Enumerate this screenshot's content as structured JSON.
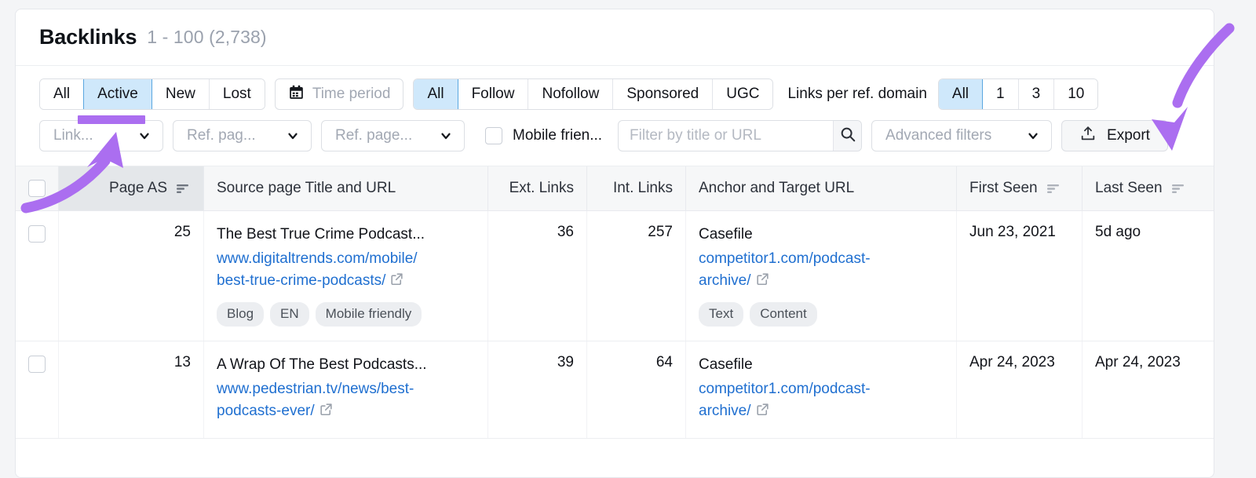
{
  "header": {
    "title": "Backlinks",
    "range_count": "1 - 100 (2,738)"
  },
  "filters": {
    "status_group": {
      "name": "backlink-status",
      "options": [
        "All",
        "Active",
        "New",
        "Lost"
      ],
      "selected": "Active"
    },
    "time_period": {
      "label": "Time period",
      "icon": "calendar-icon"
    },
    "link_type_group": {
      "name": "link-attribute",
      "options": [
        "All",
        "Follow",
        "Nofollow",
        "Sponsored",
        "UGC"
      ],
      "selected": "All"
    },
    "links_per_domain": {
      "label": "Links per ref. domain",
      "options": [
        "All",
        "1",
        "3",
        "10"
      ],
      "selected": "All"
    },
    "dropdowns": [
      {
        "name": "link-attributes-dropdown",
        "value": "Link..."
      },
      {
        "name": "ref-page-category-dropdown",
        "value": "Ref. pag..."
      },
      {
        "name": "ref-page-language-dropdown",
        "value": "Ref. page..."
      }
    ],
    "mobile_friendly": {
      "label": "Mobile frien...",
      "checked": false
    },
    "search": {
      "placeholder": "Filter by title or URL",
      "value": "",
      "icon": "search-icon"
    },
    "advanced_filters": {
      "label": "Advanced filters"
    },
    "export": {
      "label": "Export",
      "icon": "upload-icon"
    }
  },
  "table": {
    "columns": [
      {
        "key": "select",
        "label": "",
        "sortable": false,
        "sorted": false
      },
      {
        "key": "page_as",
        "label": "Page AS",
        "sortable": true,
        "sorted": true
      },
      {
        "key": "source",
        "label": "Source page Title and URL",
        "sortable": false,
        "sorted": false
      },
      {
        "key": "ext",
        "label": "Ext. Links",
        "sortable": false,
        "sorted": false
      },
      {
        "key": "int",
        "label": "Int. Links",
        "sortable": false,
        "sorted": false
      },
      {
        "key": "anchor",
        "label": "Anchor and Target URL",
        "sortable": false,
        "sorted": false
      },
      {
        "key": "first",
        "label": "First Seen",
        "sortable": true,
        "sorted": false
      },
      {
        "key": "last",
        "label": "Last Seen",
        "sortable": true,
        "sorted": false
      }
    ],
    "rows": [
      {
        "page_as": "25",
        "source_title": "The Best True Crime Podcast...",
        "source_url_line1": "www.digitaltrends.com/mobile/",
        "source_url_line2": "best-true-crime-podcasts/",
        "source_tags": [
          "Blog",
          "EN",
          "Mobile friendly"
        ],
        "ext_links": "36",
        "int_links": "257",
        "anchor_text": "Casefile",
        "target_url_line1": "competitor1.com/podcast-",
        "target_url_line2": "archive/",
        "anchor_tags": [
          "Text",
          "Content"
        ],
        "first_seen": "Jun 23, 2021",
        "last_seen": "5d ago"
      },
      {
        "page_as": "13",
        "source_title": "A Wrap Of The Best Podcasts...",
        "source_url_line1": "www.pedestrian.tv/news/best-",
        "source_url_line2": "podcasts-ever/",
        "source_tags": [],
        "ext_links": "39",
        "int_links": "64",
        "anchor_text": "Casefile",
        "target_url_line1": "competitor1.com/podcast-",
        "target_url_line2": "archive/",
        "anchor_tags": [],
        "first_seen": "Apr 24, 2023",
        "last_seen": "Apr 24, 2023"
      }
    ]
  },
  "annotations": {
    "color": "#ab6ef0",
    "items": [
      {
        "name": "arrow-to-active-filter",
        "points_to": "Active"
      },
      {
        "name": "arrow-to-export-button",
        "points_to": "Export"
      },
      {
        "name": "underline-active-filter",
        "points_to": "Active"
      }
    ]
  },
  "colors": {
    "accent_blue": "#cfe8fb",
    "accent_blue_border": "#5aa7e0",
    "link_blue": "#1f6fd0",
    "annotation_purple": "#ab6ef0",
    "header_gray": "#f6f7f8",
    "sorted_header_gray": "#e4e7ea"
  }
}
